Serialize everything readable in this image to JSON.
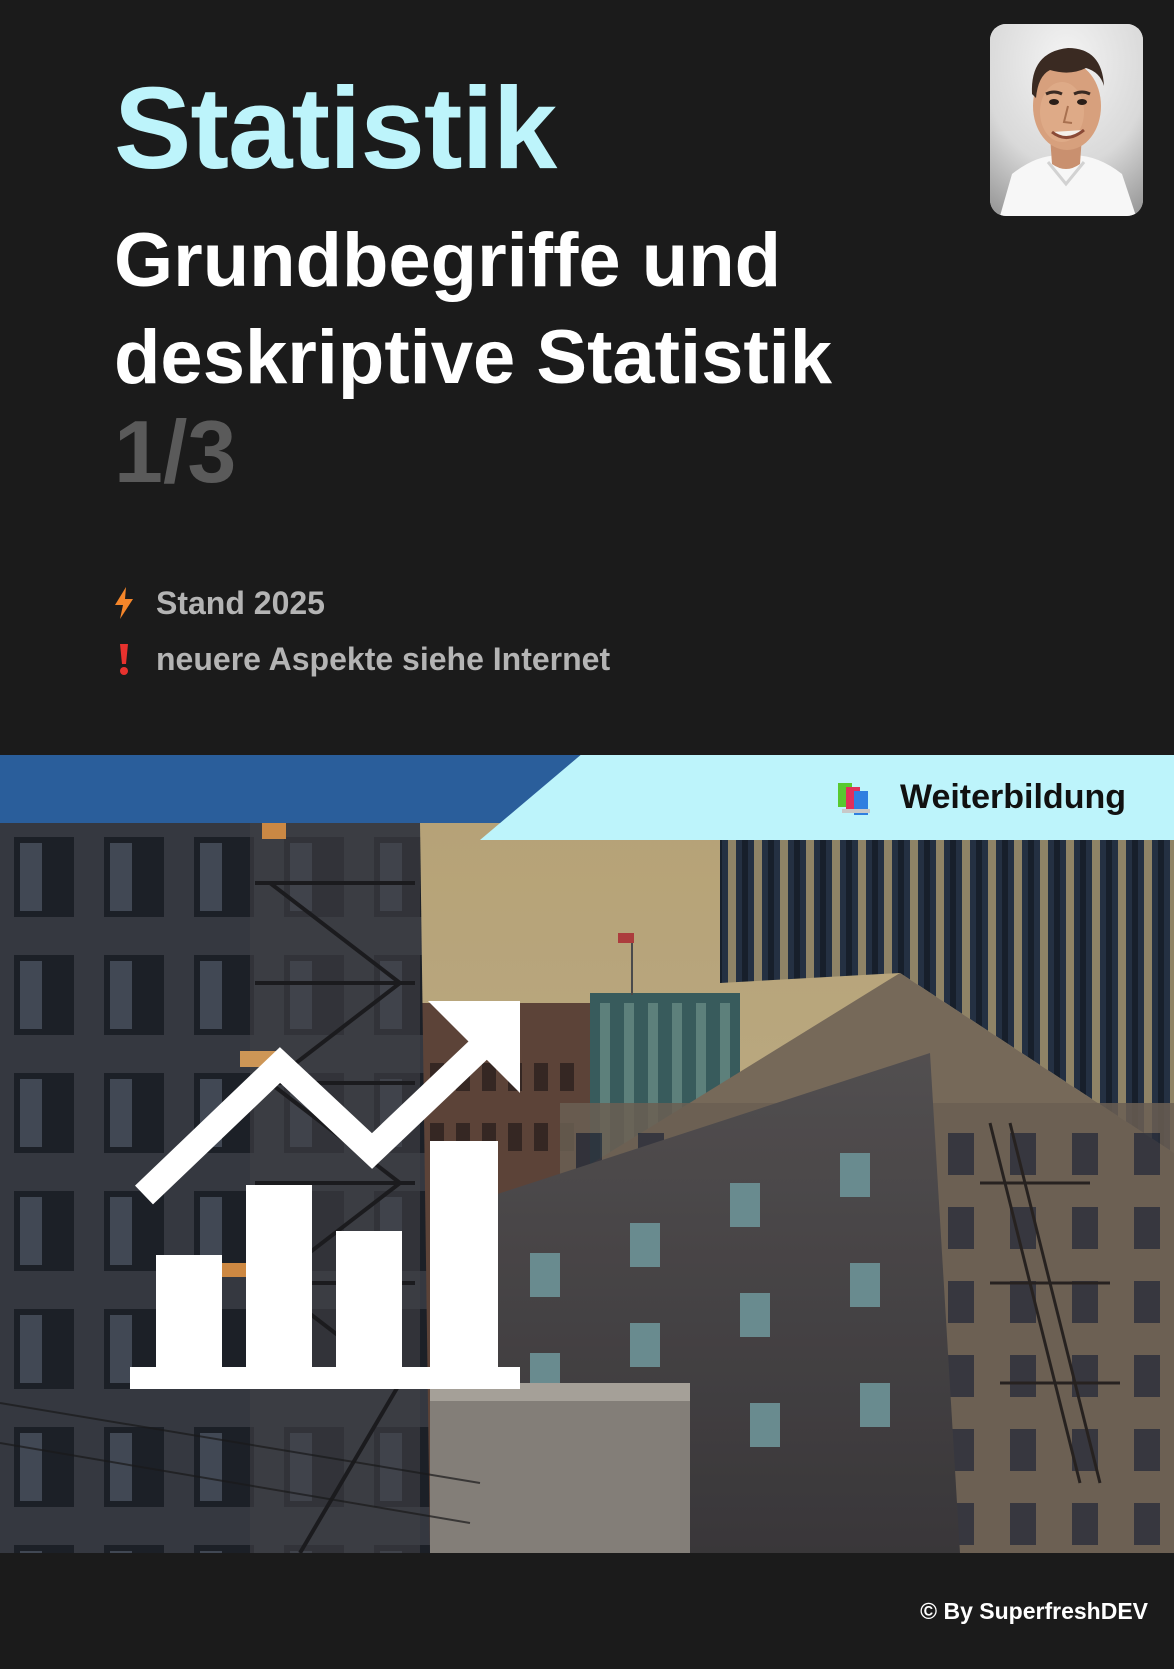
{
  "cover": {
    "title": "Statistik",
    "subtitle": "Grundbegriffe und deskriptive Statistik",
    "part": "1/3"
  },
  "notes": [
    {
      "icon": "lightning-icon",
      "text": "Stand 2025"
    },
    {
      "icon": "exclamation-icon",
      "text": "neuere Aspekte siehe Internet"
    }
  ],
  "banner": {
    "icon": "books-icon",
    "label": "Weiterbildung"
  },
  "footer": {
    "credit": "© By SuperfreshDEV"
  },
  "colors": {
    "background": "#1b1b1b",
    "title": "#bdf4fb",
    "band_blue": "#2a5e9b",
    "band_cyan": "#bdf4fb",
    "muted": "#b4b4b4"
  }
}
